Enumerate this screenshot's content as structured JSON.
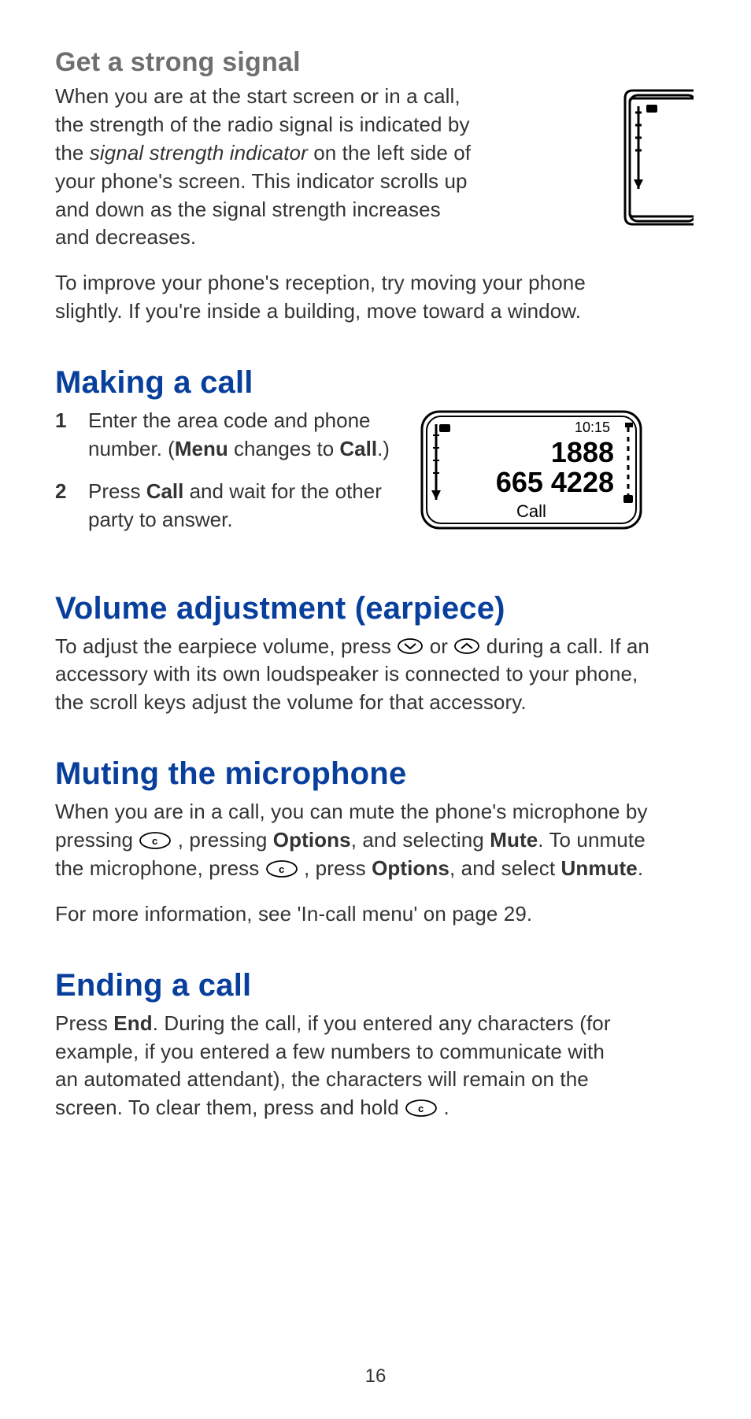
{
  "section1": {
    "title": "Get a strong signal",
    "para1_a": "When you are at the start screen or in a call, the strength of the radio signal is indicated by the ",
    "para1_em": "signal strength indicator",
    "para1_b": " on the left side of your phone's screen. This indicator scrolls up and down as the signal strength increases and decreases.",
    "para2": "To improve your phone's reception, try moving your phone slightly. If you're inside a building, move toward a window."
  },
  "section2": {
    "title": "Making a call",
    "step1_a": "Enter the area code and phone number. (",
    "step1_b1": "Menu",
    "step1_c": " changes to ",
    "step1_b2": "Call",
    "step1_d": ".)",
    "step2_a": "Press ",
    "step2_b1": "Call",
    "step2_c": " and wait for the other party to answer."
  },
  "fig2": {
    "time": "10:15",
    "line1": "1888",
    "line2": "665 4228",
    "softkey": "Call"
  },
  "section3": {
    "title": "Volume adjustment (earpiece)",
    "para_a": "To adjust the earpiece volume, press ",
    "para_mid": " or ",
    "para_b": " during a call. If an accessory with its own loudspeaker is connected to your phone, the scroll keys adjust the volume for that accessory."
  },
  "section4": {
    "title": "Muting the microphone",
    "para1_a": "When you are in a call, you can mute the phone's microphone by pressing ",
    "para1_b": " , pressing ",
    "para1_b1": "Options",
    "para1_c": ", and selecting ",
    "para1_b2": "Mute",
    "para1_d": ". To unmute the microphone, press ",
    "para1_e": " , press ",
    "para1_b3": "Options",
    "para1_f": ", and select ",
    "para1_b4": "Unmute",
    "para1_g": ".",
    "para2": "For more information, see 'In-call menu' on page 29."
  },
  "section5": {
    "title": "Ending a call",
    "para_a": "Press ",
    "para_b1": "End",
    "para_b": ". During the call, if you entered any characters (for example, if you entered a few numbers to communicate with an automated attendant), the characters will remain on the screen. To clear them, press and hold ",
    "para_c": " ."
  },
  "pagenum": "16",
  "glyph_names": {
    "scroll_down": "scroll-down-key-icon",
    "scroll_up": "scroll-up-key-icon",
    "c_key": "c-key-icon"
  }
}
